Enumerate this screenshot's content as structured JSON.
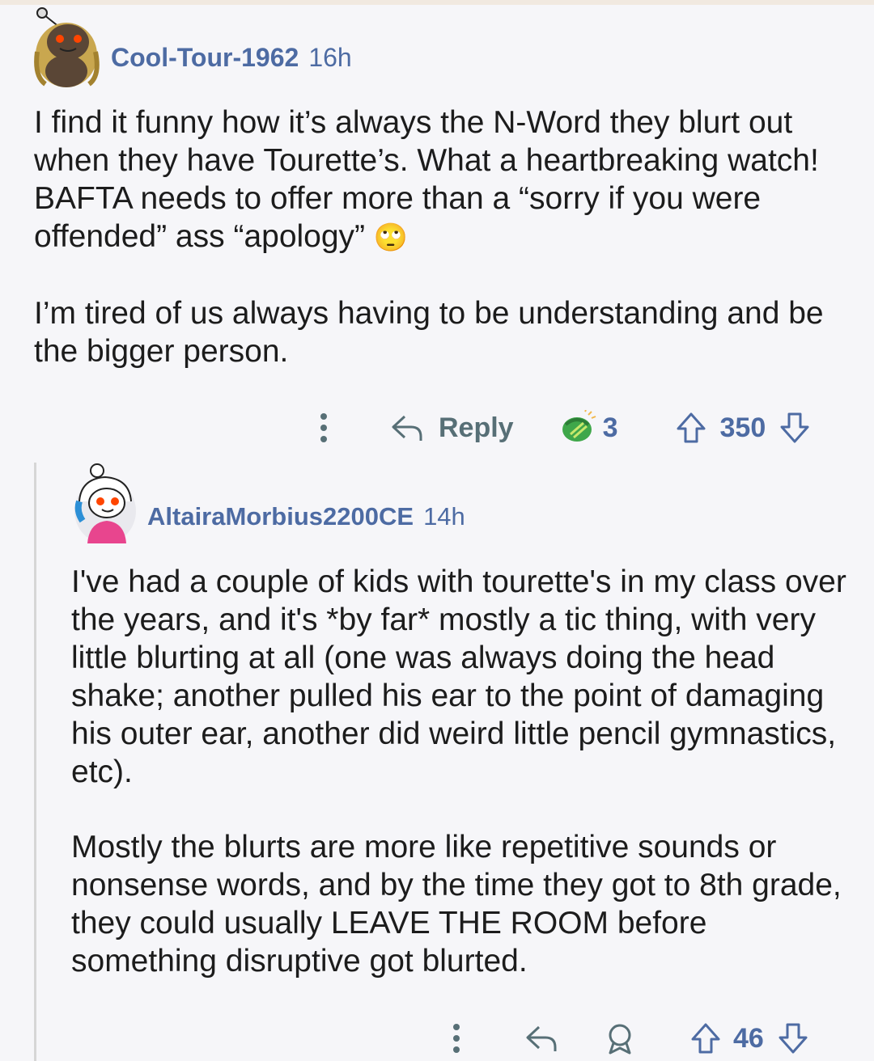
{
  "comment": {
    "username": "Cool-Tour-1962",
    "time": "16h",
    "paragraphs": [
      "I find it funny how it’s always the N-Word they blurt out when they have Tourette’s. What a heartbreaking watch! BAFTA needs to offer more than a “sorry if you were offended” ass “apology”",
      "I’m tired of us always having to be understanding and be the bigger person."
    ],
    "emoji": "🙄",
    "actions": {
      "reply_label": "Reply",
      "award_count": "3",
      "score": "350"
    }
  },
  "reply": {
    "username": "AltairaMorbius2200CE",
    "time": "14h",
    "paragraphs": [
      "I've had a couple of kids with tourette's in my class over the years, and it's *by far* mostly a tic thing, with very little blurting at all (one was always doing the head shake; another pulled his ear to the point of damaging his outer ear, another did weird little pencil gymnastics, etc).",
      "Mostly the blurts are more like repetitive sounds or nonsense words, and by the time they got to 8th grade, they could usually LEAVE THE ROOM before something disruptive got blurted."
    ],
    "actions": {
      "score": "46"
    }
  },
  "colors": {
    "username": "#4d6ba3",
    "text": "#1c1c1c",
    "icon": "#576f76",
    "background": "#f6f6f9"
  },
  "icons": [
    "more-options-icon",
    "reply-arrow-icon",
    "award-icon",
    "upvote-icon",
    "downvote-icon"
  ]
}
